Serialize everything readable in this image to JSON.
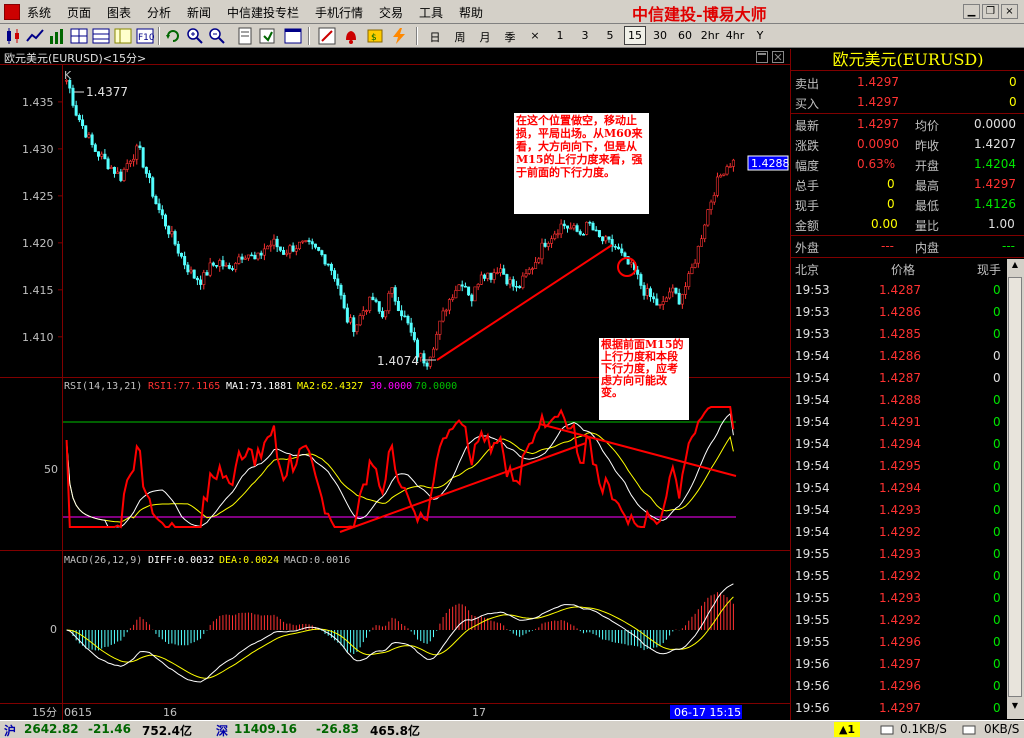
{
  "menu": {
    "items": [
      "系统",
      "页面",
      "图表",
      "分析",
      "新闻",
      "中信建投专栏",
      "手机行情",
      "交易",
      "工具",
      "帮助"
    ],
    "app_title": "中信建投-博易大师"
  },
  "toolbar": {
    "periods": [
      "日",
      "周",
      "月",
      "季",
      "×",
      "1",
      "3",
      "5",
      "15",
      "30",
      "60",
      "2hr",
      "4hr",
      "Y"
    ],
    "active_period": "15"
  },
  "chart": {
    "title": "欧元美元(EURUSD)<15分>",
    "k_label": "K",
    "price_ticks": [
      "1.435",
      "1.430",
      "1.425",
      "1.420",
      "1.415",
      "1.410"
    ],
    "high_label": "1.4377",
    "low_label": "1.4074",
    "current_price_tag": "1.4288",
    "annotation_top": "在这个位置做空，移动止损，平局出场。从M60来看，大方向向下，但是从M15的上行力度来看，强于前面的下行力度。",
    "annotation_bottom": "根据前面M15的上行力度和本段下行力度，应考虑方向可能改变。",
    "rsi": {
      "params": "RSI(14,13,21)",
      "rsi1": "RSI1:77.1165",
      "ma1": "MA1:73.1881",
      "ma2": "MA2:62.4327",
      "l30": "30.0000",
      "l70": "70.0000",
      "tick_50": "50"
    },
    "macd": {
      "params": "MACD(26,12,9)",
      "diff": "DIFF:0.0032",
      "dea": "DEA:0.0024",
      "macd": "MACD:0.0016",
      "tick_0": "0"
    },
    "xaxis": {
      "period": "15分",
      "labels": [
        "0615",
        "16",
        "17"
      ],
      "cursor_time": "06-17 15:15"
    }
  },
  "chart_data": {
    "type": "candlestick",
    "instrument": "EURUSD",
    "interval": "15min",
    "ylim": [
      1.407,
      1.4385
    ],
    "yticks": [
      1.435,
      1.43,
      1.425,
      1.42,
      1.415,
      1.41
    ],
    "high": 1.4377,
    "low": 1.4074,
    "last": 1.4288,
    "close_path": [
      1.4377,
      1.434,
      1.432,
      1.43,
      1.429,
      1.428,
      1.427,
      1.429,
      1.43,
      1.427,
      1.424,
      1.422,
      1.42,
      1.418,
      1.4165,
      1.416,
      1.4175,
      1.418,
      1.417,
      1.4185,
      1.419,
      1.418,
      1.4195,
      1.42,
      1.419,
      1.4195,
      1.4198,
      1.4196,
      1.419,
      1.418,
      1.416,
      1.412,
      1.411,
      1.413,
      1.414,
      1.412,
      1.415,
      1.413,
      1.411,
      1.408,
      1.4074,
      1.41,
      1.413,
      1.415,
      1.416,
      1.414,
      1.417,
      1.4165,
      1.4175,
      1.416,
      1.415,
      1.4165,
      1.418,
      1.42,
      1.421,
      1.422,
      1.4215,
      1.421,
      1.422,
      1.4205,
      1.42,
      1.4195,
      1.418,
      1.417,
      1.415,
      1.414,
      1.413,
      1.415,
      1.414,
      1.416,
      1.419,
      1.423,
      1.426,
      1.428,
      1.4288
    ],
    "rsi": {
      "levels": [
        30,
        70
      ],
      "ylim": [
        0,
        100
      ],
      "tick": 50,
      "rsi1_last": 77.1165,
      "ma1_last": 73.1881,
      "ma2_last": 62.4327
    },
    "macd": {
      "diff_last": 0.0032,
      "dea_last": 0.0024,
      "macd_last": 0.0016,
      "tick": 0
    },
    "x_labels": [
      "0615",
      "16",
      "17"
    ]
  },
  "quote": {
    "header": "欧元美元(EURUSD)",
    "sell": {
      "label": "卖出",
      "price": "1.4297",
      "vol": "0"
    },
    "buy": {
      "label": "买入",
      "price": "1.4297",
      "vol": "0"
    },
    "rows": [
      {
        "l1": "最新",
        "v1": "1.4297",
        "l2": "均价",
        "v2": "0.0000"
      },
      {
        "l1": "涨跌",
        "v1": "0.0090",
        "l2": "昨收",
        "v2": "1.4207"
      },
      {
        "l1": "幅度",
        "v1": "0.63%",
        "l2": "开盘",
        "v2": "1.4204"
      },
      {
        "l1": "总手",
        "v1": "0",
        "l2": "最高",
        "v2": "1.4297"
      },
      {
        "l1": "现手",
        "v1": "0",
        "l2": "最低",
        "v2": "1.4126"
      },
      {
        "l1": "金额",
        "v1": "0.00",
        "l2": "量比",
        "v2": "1.00"
      }
    ],
    "outer": {
      "label": "外盘",
      "value": "---"
    },
    "inner": {
      "label": "内盘",
      "value": "---"
    },
    "tick_headers": {
      "time": "北京",
      "price": "价格",
      "vol": "现手"
    },
    "ticks": [
      {
        "t": "19:53",
        "p": "1.4287",
        "v": "0"
      },
      {
        "t": "19:53",
        "p": "1.4286",
        "v": "0"
      },
      {
        "t": "19:53",
        "p": "1.4285",
        "v": "0"
      },
      {
        "t": "19:54",
        "p": "1.4286",
        "v": "0"
      },
      {
        "t": "19:54",
        "p": "1.4287",
        "v": "0"
      },
      {
        "t": "19:54",
        "p": "1.4288",
        "v": "0"
      },
      {
        "t": "19:54",
        "p": "1.4291",
        "v": "0"
      },
      {
        "t": "19:54",
        "p": "1.4294",
        "v": "0"
      },
      {
        "t": "19:54",
        "p": "1.4295",
        "v": "0"
      },
      {
        "t": "19:54",
        "p": "1.4294",
        "v": "0"
      },
      {
        "t": "19:54",
        "p": "1.4293",
        "v": "0"
      },
      {
        "t": "19:54",
        "p": "1.4292",
        "v": "0"
      },
      {
        "t": "19:55",
        "p": "1.4293",
        "v": "0"
      },
      {
        "t": "19:55",
        "p": "1.4292",
        "v": "0"
      },
      {
        "t": "19:55",
        "p": "1.4293",
        "v": "0"
      },
      {
        "t": "19:55",
        "p": "1.4292",
        "v": "0"
      },
      {
        "t": "19:55",
        "p": "1.4296",
        "v": "0"
      },
      {
        "t": "19:56",
        "p": "1.4297",
        "v": "0"
      },
      {
        "t": "19:56",
        "p": "1.4296",
        "v": "0"
      },
      {
        "t": "19:56",
        "p": "1.4297",
        "v": "0"
      }
    ]
  },
  "status": {
    "sh_label": "沪",
    "sh_index": "2642.82",
    "sh_change": "-21.46",
    "sh_amount": "752.4亿",
    "sz_label": "深",
    "sz_index": "11409.16",
    "sz_change": "-26.83",
    "sz_amount": "465.8亿",
    "alarm": "▲1",
    "up_speed": "0.1KB/S",
    "down_speed": "0KB/S"
  },
  "colors": {
    "up": "#ff3232",
    "down": "#54ffff",
    "rsi1": "#ff0000",
    "ma1": "#ffffff",
    "ma2": "#ffff00",
    "level70": "#00c000",
    "level30": "#ff00ff",
    "trendline": "#ff0000"
  }
}
